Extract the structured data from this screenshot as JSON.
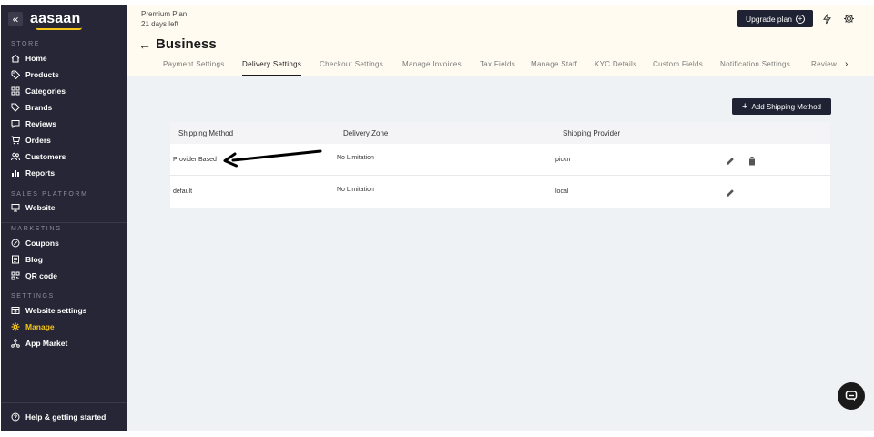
{
  "sidebar": {
    "logo": "aasaan",
    "collapse_glyph": "«",
    "sections": {
      "store": "STORE",
      "sales_platform": "SALES PLATFORM",
      "marketing": "MARKETING",
      "settings": "SETTINGS"
    },
    "items": {
      "home": "Home",
      "products": "Products",
      "categories": "Categories",
      "brands": "Brands",
      "reviews": "Reviews",
      "orders": "Orders",
      "customers": "Customers",
      "reports": "Reports",
      "website": "Website",
      "coupons": "Coupons",
      "blog": "Blog",
      "qr_code": "QR code",
      "website_settings": "Website settings",
      "manage": "Manage",
      "app_market": "App Market"
    },
    "help": "Help & getting started",
    "accent_color": "#f5c518"
  },
  "topbar": {
    "plan_name": "Premium Plan",
    "days_left": "21 days left",
    "back_glyph": "←",
    "page_title": "Business",
    "upgrade_label": "Upgrade plan",
    "icons": [
      "plus-circle-icon",
      "lightning-icon",
      "gear-icon"
    ]
  },
  "tabs": [
    "Payment Settings",
    "Delivery Settings",
    "Checkout Settings",
    "Manage Invoices",
    "Tax Fields",
    "Manage Staff",
    "KYC Details",
    "Custom Fields",
    "Notification Settings",
    "Review"
  ],
  "active_tab": "Delivery Settings",
  "main": {
    "add_button_label": "Add Shipping Method",
    "table": {
      "headers": [
        "Shipping Method",
        "Delivery Zone",
        "Shipping Provider"
      ],
      "rows": [
        {
          "method": "Provider Based",
          "zone": "No Limitation",
          "provider": "pickrr",
          "actions": [
            "pencil-icon",
            "trash-icon"
          ]
        },
        {
          "method": "default",
          "zone": "No Limitation",
          "provider": "local",
          "actions": [
            "pencil-icon"
          ]
        }
      ]
    }
  },
  "colors": {
    "sidebar_bg": "#262636",
    "button_bg": "#1f2233",
    "banner_bg": "#fffbf0",
    "main_bg": "#eff2f5"
  }
}
